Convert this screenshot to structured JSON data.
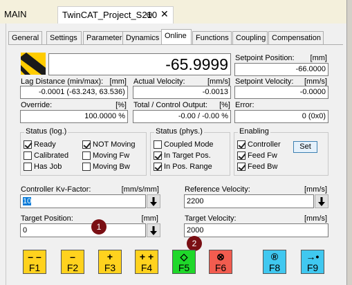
{
  "doc_tabs": {
    "main": "MAIN",
    "active": "TwinCAT_Project_S210",
    "pin": "⊕",
    "close": "✕"
  },
  "tabs": [
    "General",
    "Settings",
    "Parameter",
    "Dynamics",
    "Online",
    "Functions",
    "Coupling",
    "Compensation"
  ],
  "active_tab": "Online",
  "position": {
    "value": "-65.9999"
  },
  "setpoint_position": {
    "label": "Setpoint Position:",
    "unit": "[mm]",
    "value": "-66.0000"
  },
  "lag_distance": {
    "label": "Lag Distance (min/max):",
    "unit": "[mm]",
    "value": "-0.0001",
    "minmax": "(-63.243, 63.536)"
  },
  "actual_velocity": {
    "label": "Actual Velocity:",
    "unit": "[mm/s]",
    "value": "-0.0013"
  },
  "setpoint_velocity": {
    "label": "Setpoint Velocity:",
    "unit": "[mm/s]",
    "value": "-0.0000"
  },
  "override": {
    "label": "Override:",
    "unit": "[%]",
    "value": "100.0000 %"
  },
  "control_output": {
    "label": "Total / Control Output:",
    "unit": "[%]",
    "value": "-0.00 / -0.00 %"
  },
  "error": {
    "label": "Error:",
    "value": "0 (0x0)"
  },
  "status_log": {
    "title": "Status (log.)",
    "items": [
      {
        "label": "Ready",
        "checked": true
      },
      {
        "label": "Calibrated",
        "checked": false
      },
      {
        "label": "Has Job",
        "checked": false
      },
      {
        "label": "NOT Moving",
        "checked": true
      },
      {
        "label": "Moving Fw",
        "checked": false
      },
      {
        "label": "Moving Bw",
        "checked": false
      }
    ]
  },
  "status_phys": {
    "title": "Status (phys.)",
    "items": [
      {
        "label": "Coupled Mode",
        "checked": false
      },
      {
        "label": "In Target Pos.",
        "checked": true
      },
      {
        "label": "In Pos. Range",
        "checked": true
      }
    ]
  },
  "enabling": {
    "title": "Enabling",
    "items": [
      {
        "label": "Controller",
        "checked": true
      },
      {
        "label": "Feed Fw",
        "checked": true
      },
      {
        "label": "Feed Bw",
        "checked": true
      }
    ],
    "set_label": "Set"
  },
  "kv_factor": {
    "label": "Controller Kv-Factor:",
    "unit": "[mm/s/mm]",
    "value": "10"
  },
  "reference_velocity": {
    "label": "Reference Velocity:",
    "unit": "[mm/s]",
    "value": "2200"
  },
  "target_position": {
    "label": "Target Position:",
    "unit": "[mm]",
    "value": "0"
  },
  "target_velocity": {
    "label": "Target Velocity:",
    "unit": "[mm/s]",
    "value": "2000"
  },
  "markers": [
    "1",
    "2"
  ],
  "fkeys": [
    {
      "key": "F1",
      "symbol": "– –",
      "color": "#ffd21e"
    },
    {
      "key": "F2",
      "symbol": "–",
      "color": "#ffd21e"
    },
    {
      "key": "F3",
      "symbol": "+",
      "color": "#ffd21e"
    },
    {
      "key": "F4",
      "symbol": "+ +",
      "color": "#ffd21e"
    },
    {
      "key": "F5",
      "symbol": "◇",
      "color": "#1fd82a"
    },
    {
      "key": "F6",
      "symbol": "⊗",
      "color": "#f25c4f"
    },
    {
      "key": "F8",
      "symbol": "®",
      "color": "#40c8f0"
    },
    {
      "key": "F9",
      "symbol": "→•",
      "color": "#40c8f0"
    }
  ]
}
